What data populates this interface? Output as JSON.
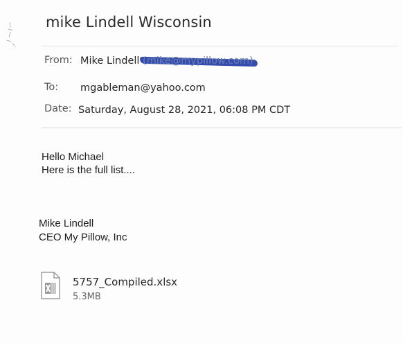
{
  "email": {
    "subject": "mike Lindell Wisconsin",
    "from_label": "From:",
    "from_name": "Mike Lindell",
    "from_address_redacted": "(mike@mypillow.com)",
    "to_label": "To:",
    "to_value": "mgableman@yahoo.com",
    "date_label": "Date:",
    "date_value": "Saturday, August 28, 2021, 06:08 PM CDT",
    "body_lines": [
      "Hello Michael",
      "Here is the full list...."
    ],
    "signature_lines": [
      "Mike Lindell",
      "CEO My Pillow, Inc"
    ]
  },
  "attachment": {
    "icon": "excel-file-icon",
    "filename": "5757_Compiled.xlsx",
    "size": "5.3MB"
  },
  "colors": {
    "redaction_ink": "#1f3a9e",
    "divider": "#e3e3e3",
    "excel_icon_accent": "#7a7a7a"
  }
}
